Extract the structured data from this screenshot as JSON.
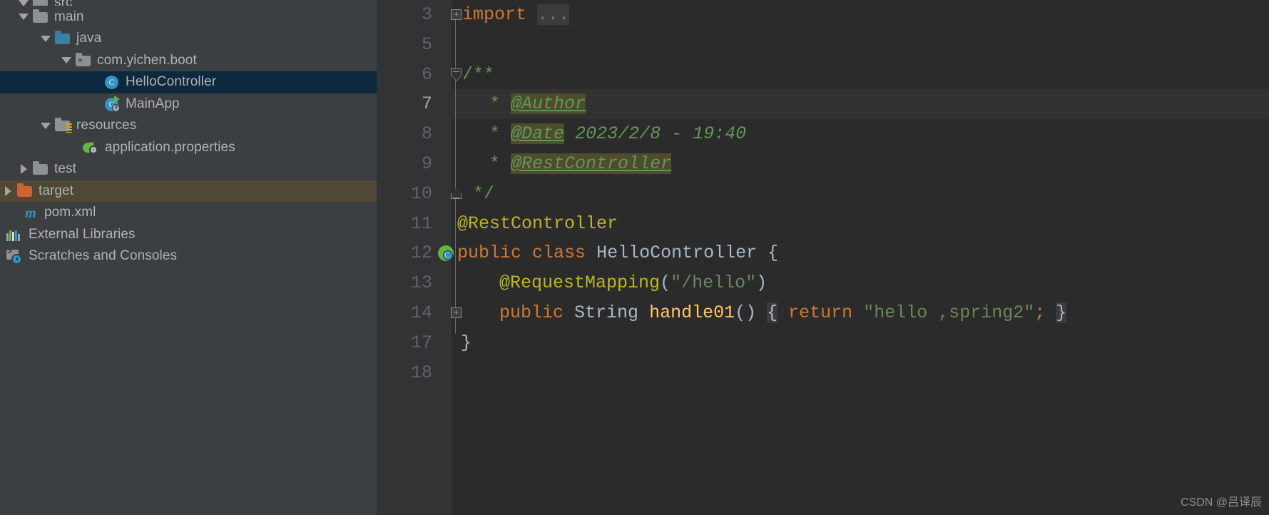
{
  "project_tree": {
    "name": "Project tool window",
    "items": [
      {
        "id": "src",
        "label": "src",
        "indent": 1,
        "arrow": "down",
        "icon": "folder-grey-icon",
        "state": "partial"
      },
      {
        "id": "main",
        "label": "main",
        "indent": 1,
        "arrow": "down",
        "icon": "folder-grey-icon",
        "state": "normal"
      },
      {
        "id": "java",
        "label": "java",
        "indent": 2,
        "arrow": "down",
        "icon": "folder-blue-icon",
        "state": "normal"
      },
      {
        "id": "package",
        "label": "com.yichen.boot",
        "indent": 3,
        "arrow": "down",
        "icon": "folder-package-icon",
        "state": "normal"
      },
      {
        "id": "hellocontroller",
        "label": "HelloController",
        "indent": 5,
        "arrow": "none",
        "icon": "java-class-icon",
        "state": "selected"
      },
      {
        "id": "mainapp",
        "label": "MainApp",
        "indent": 5,
        "arrow": "none",
        "icon": "java-runnable-class-icon",
        "state": "normal"
      },
      {
        "id": "resources",
        "label": "resources",
        "indent": 2,
        "arrow": "down",
        "icon": "folder-resources-icon",
        "state": "normal"
      },
      {
        "id": "application-properties",
        "label": "application.properties",
        "indent": 4,
        "arrow": "none",
        "icon": "spring-properties-icon",
        "state": "normal"
      },
      {
        "id": "test",
        "label": "test",
        "indent": 1,
        "arrow": "right",
        "icon": "folder-grey-icon",
        "state": "normal"
      },
      {
        "id": "target",
        "label": "target",
        "indent": 0,
        "arrow": "right",
        "icon": "folder-orange-icon",
        "state": "highlight"
      },
      {
        "id": "pom-xml",
        "label": "pom.xml",
        "indent": 1,
        "arrow": "none",
        "icon": "maven-icon",
        "state": "normal"
      },
      {
        "id": "external-libraries",
        "label": "External Libraries",
        "indent": 0,
        "arrow": "none",
        "icon": "libraries-icon",
        "state": "normal"
      },
      {
        "id": "scratches",
        "label": "Scratches and Consoles",
        "indent": 0,
        "arrow": "none",
        "icon": "scratches-icon",
        "state": "normal"
      }
    ]
  },
  "editor": {
    "name": "HelloController.java editor",
    "line_numbers": [
      "3",
      "5",
      "6",
      "7",
      "8",
      "9",
      "10",
      "11",
      "12",
      "13",
      "14",
      "17",
      "18"
    ],
    "current_line": "7",
    "lines": {
      "l3_import": "import",
      "l3_folded": "...",
      "l6_javadoc_open": "/**",
      "l7_star": "*",
      "l7_tag": "@Author",
      "l8_star": "*",
      "l8_tag": "@Date",
      "l8_value": "2023/2/8 - 19:40",
      "l9_star": "*",
      "l9_tag": "@RestController",
      "l10_javadoc_close": "*/",
      "l11_annotation": "@RestController",
      "l12_public": "public",
      "l12_class": "class",
      "l12_name": "HelloController",
      "l12_brace": "{",
      "l13_annotation": "@RequestMapping",
      "l13_open_paren": "(",
      "l13_string": "\"/hello\"",
      "l13_close_paren": ")",
      "l14_public": "public",
      "l14_type": "String",
      "l14_method": "handle01",
      "l14_parens": "()",
      "l14_open_brace": "{",
      "l14_return": "return",
      "l14_string": "\"hello ,spring2\"",
      "l14_semicolon": ";",
      "l14_close_brace": "}",
      "l17_close": "}"
    },
    "gutter_icons": {
      "l3": "fold-plus-icon",
      "l6": "fold-minus-icon",
      "l10": "fold-end-icon",
      "l12": "run-class-icon",
      "l14": "fold-plus-icon"
    }
  },
  "watermark": {
    "text": "CSDN @吕译辰"
  },
  "colors": {
    "sidebar_bg": "#3c3f41",
    "editor_bg": "#2b2b2b",
    "gutter_bg": "#313335",
    "selected_row": "#0d293e",
    "highlight_row": "#4e4834",
    "keyword": "#cc7832",
    "annotation": "#bbb529",
    "string": "#6a8759",
    "javadoc": "#629755",
    "method": "#ffc66d",
    "identifier": "#a9b7c6",
    "javadoc_tag_highlight": "#4e4b2f"
  }
}
